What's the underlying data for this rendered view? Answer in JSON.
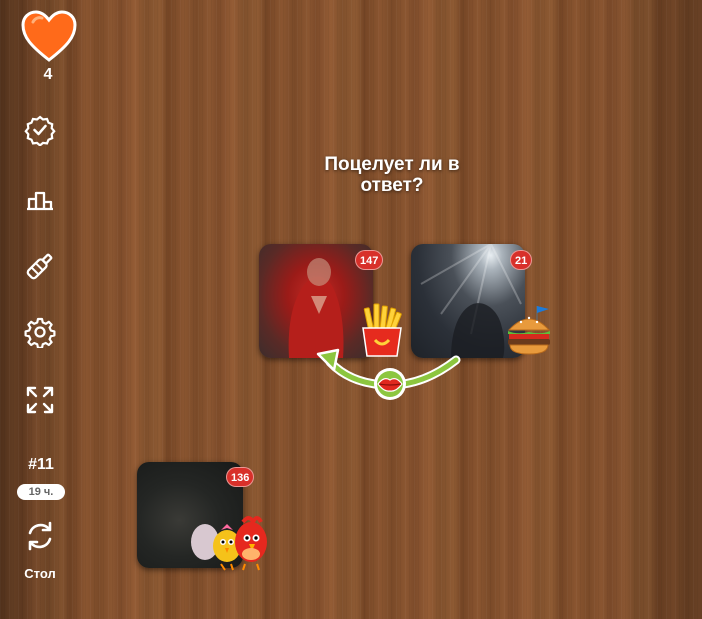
{
  "sidebar": {
    "hearts": "4",
    "icons": [
      "badge-check-icon",
      "podium-icon",
      "bottle-icon",
      "gear-icon",
      "fullscreen-icon",
      "refresh-icon"
    ],
    "table_number": "#11",
    "table_time": "19 ч.",
    "table_label": "Стол"
  },
  "game": {
    "question": "Поцелует ли в ответ?",
    "players": [
      {
        "name": "player-1",
        "count": "147",
        "gift": "fries-icon"
      },
      {
        "name": "player-2",
        "count": "21",
        "gift": "burger-icon"
      },
      {
        "name": "player-3",
        "count": "136",
        "gift": "birds-icon"
      }
    ],
    "kiss_icon": "lips-icon"
  },
  "colors": {
    "heart": "#ff6a1a",
    "badge": "#d8302a",
    "arrow": "#8cc63f"
  }
}
